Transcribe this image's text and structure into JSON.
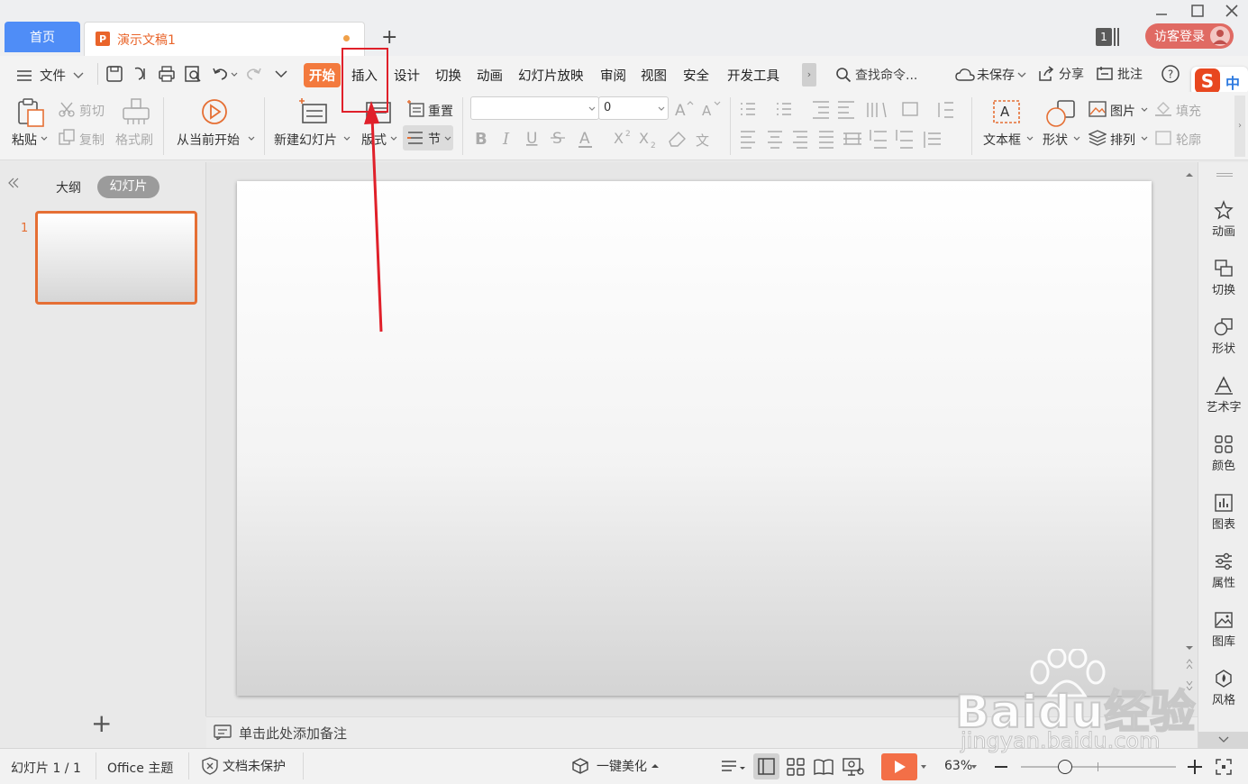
{
  "tabs": {
    "home": "首页",
    "document": "演示文稿1",
    "new_tab": "+"
  },
  "titlebar": {
    "window_count": "1",
    "login": "访客登录"
  },
  "menu": {
    "file": "文件",
    "items": [
      "开始",
      "插入",
      "设计",
      "切换",
      "动画",
      "幻灯片放映",
      "审阅",
      "视图",
      "安全",
      "开发工具"
    ],
    "search": "查找命令...",
    "unsaved": "未保存",
    "share": "分享",
    "comment": "批注",
    "ime": "中"
  },
  "ribbon": {
    "paste": "粘贴",
    "cut": "剪切",
    "copy": "复制",
    "format_painter": "格式刷",
    "start_from_current": "从当前开始",
    "new_slide": "新建幻灯片",
    "layout": "版式",
    "reset": "重置",
    "section": "节",
    "font_name": "",
    "font_size": "0",
    "text_box": "文本框",
    "shape": "形状",
    "picture": "图片",
    "arrange": "排列",
    "fill": "填充",
    "outline": "轮廓"
  },
  "left_pane": {
    "tab_outline": "大纲",
    "tab_slides": "幻灯片",
    "slide_number": "1",
    "add": "+"
  },
  "notes": {
    "placeholder": "单击此处添加备注"
  },
  "right_panel": [
    "动画",
    "切换",
    "形状",
    "艺术字",
    "颜色",
    "图表",
    "属性",
    "图库",
    "风格"
  ],
  "status": {
    "slide_count": "幻灯片 1 / 1",
    "theme": "Office 主题",
    "protection": "文档未保护",
    "beautify": "一键美化",
    "zoom": "63%"
  },
  "watermark": {
    "brand": "Baidu经验",
    "url": "jingyan.baidu.com"
  },
  "colors": {
    "accent": "#f37a3e",
    "home_tab": "#4f8df7",
    "annotation": "#e0202a",
    "login": "#e06a63"
  }
}
